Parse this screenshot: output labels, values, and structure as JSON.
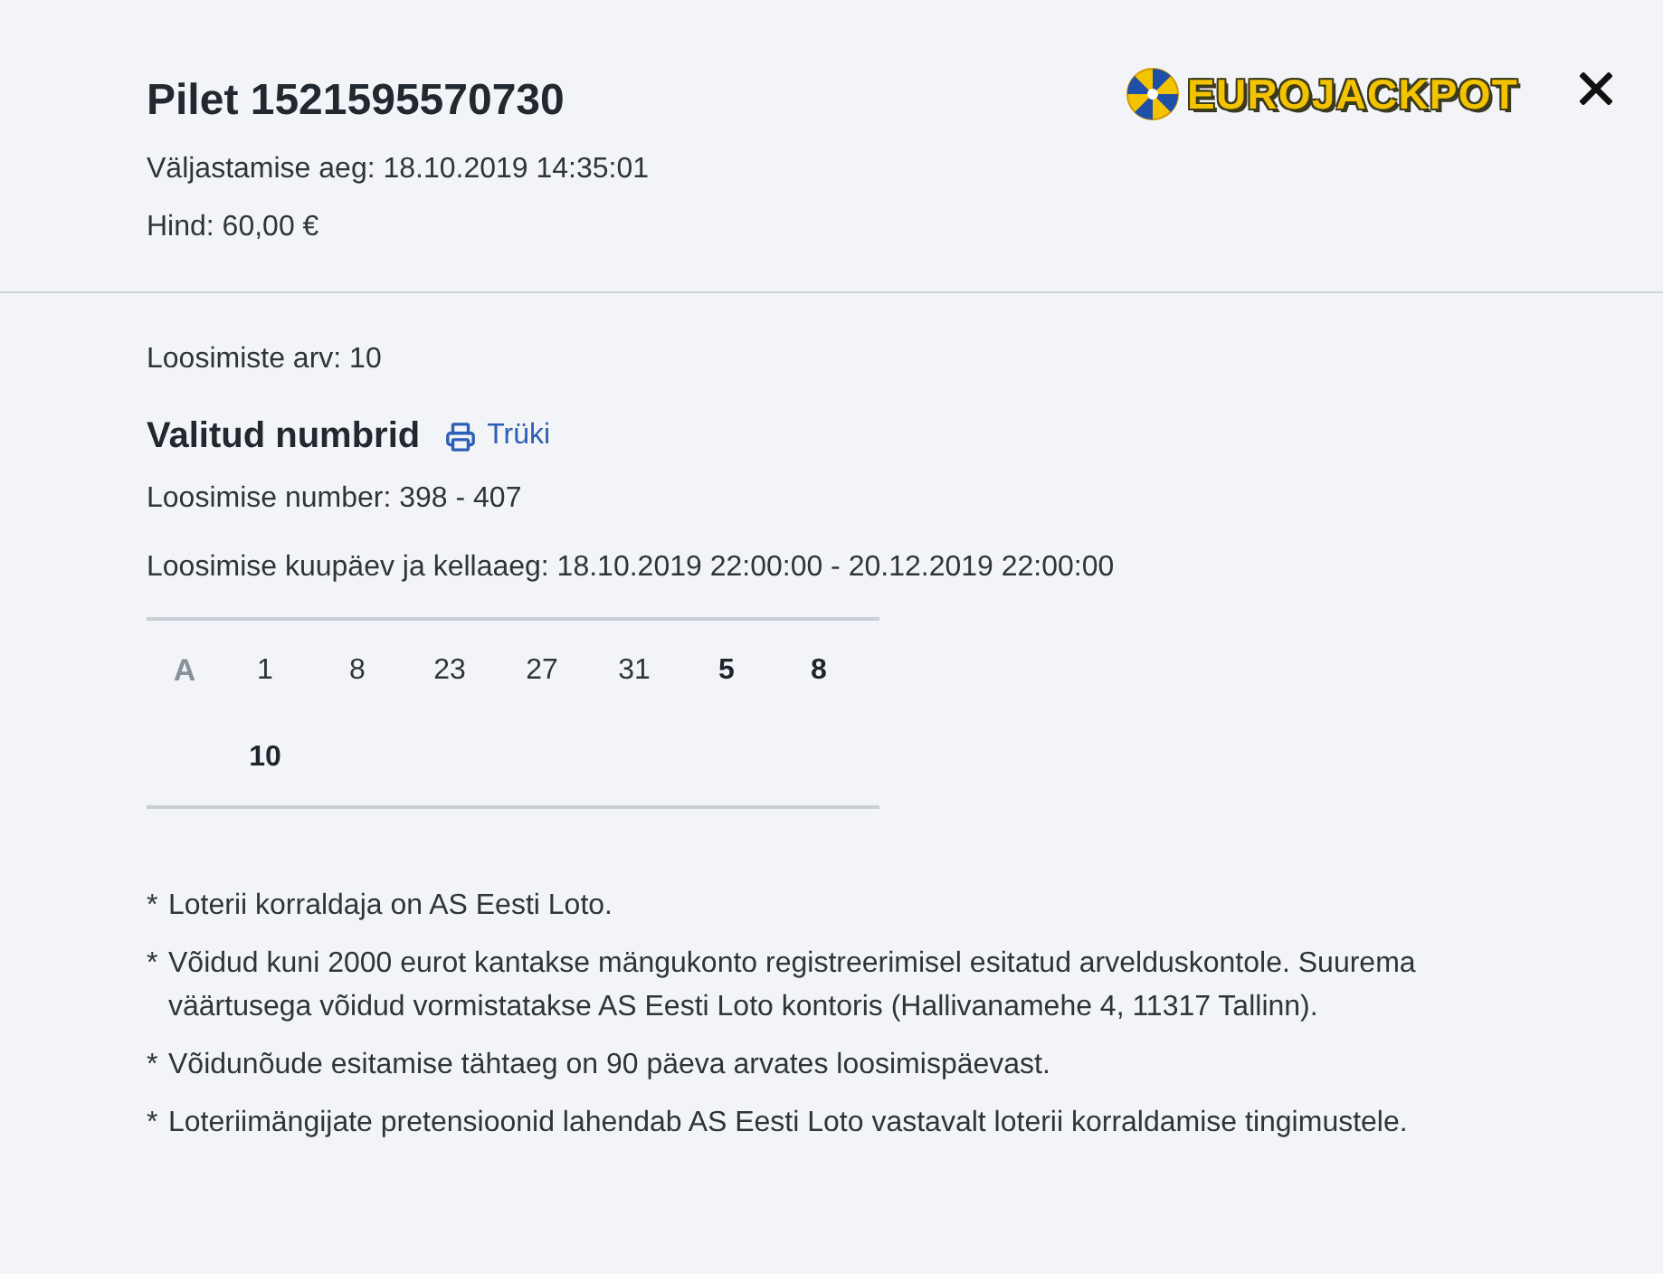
{
  "ticket": {
    "title": "Pilet 1521595570730",
    "issued": "Väljastamise aeg: 18.10.2019 14:35:01",
    "price": "Hind: 60,00 €"
  },
  "logo": {
    "text": "EUROJACKPOT"
  },
  "draws": {
    "count": "Loosimiste arv: 10",
    "heading": "Valitud numbrid",
    "print_link": "Trüki",
    "draw_numbers": "Loosimise number: 398 - 407",
    "draw_dates": "Loosimise kuupäev ja kellaaeg: 18.10.2019 22:00:00 - 20.12.2019 22:00:00"
  },
  "lines": [
    {
      "label": "A",
      "numbers": [
        {
          "value": "1",
          "kind": "main"
        },
        {
          "value": "8",
          "kind": "main"
        },
        {
          "value": "23",
          "kind": "main"
        },
        {
          "value": "27",
          "kind": "main"
        },
        {
          "value": "31",
          "kind": "main"
        },
        {
          "value": "5",
          "kind": "euro"
        },
        {
          "value": "8",
          "kind": "euro"
        },
        {
          "value": "10",
          "kind": "euro"
        }
      ]
    }
  ],
  "notes": [
    {
      "marker": "*",
      "text": "Loterii korraldaja on AS Eesti Loto."
    },
    {
      "marker": "*",
      "text": "Võidud kuni 2000 eurot kantakse mängukonto registreerimisel esitatud arvelduskontole. Suurema väärtusega võidud vormistatakse AS Eesti Loto kontoris (Hallivanamehe 4, 11317 Tallinn)."
    },
    {
      "marker": "*",
      "text": "Võidunõude esitamise tähtaeg on 90 päeva arvates loosimispäevast."
    },
    {
      "marker": "*",
      "text": "Loteriimängijate pretensioonid lahendab AS Eesti Loto vastavalt loterii korraldamise tingimustele."
    }
  ]
}
